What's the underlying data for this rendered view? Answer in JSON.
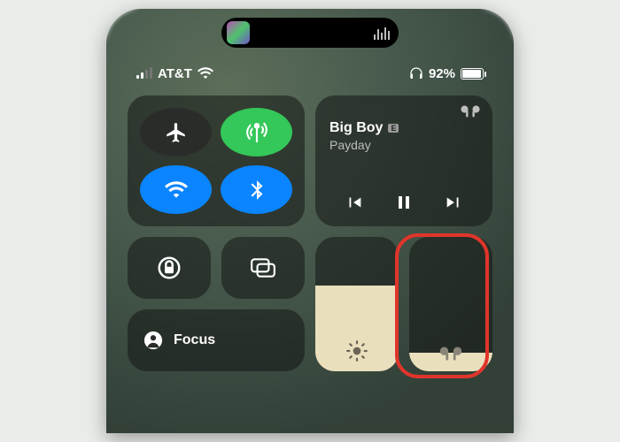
{
  "status": {
    "carrier": "AT&T",
    "battery_percent": "92%",
    "signal_bars_active": 2,
    "signal_bars_total": 4
  },
  "media": {
    "track_title": "Big Boy",
    "track_subtitle": "Payday",
    "explicit_badge": "E"
  },
  "focus": {
    "label": "Focus"
  },
  "sliders": {
    "brightness_pct": 64,
    "volume_pct": 14
  },
  "toggles": {
    "airplane": false,
    "cellular": true,
    "wifi": true,
    "bluetooth": true
  }
}
